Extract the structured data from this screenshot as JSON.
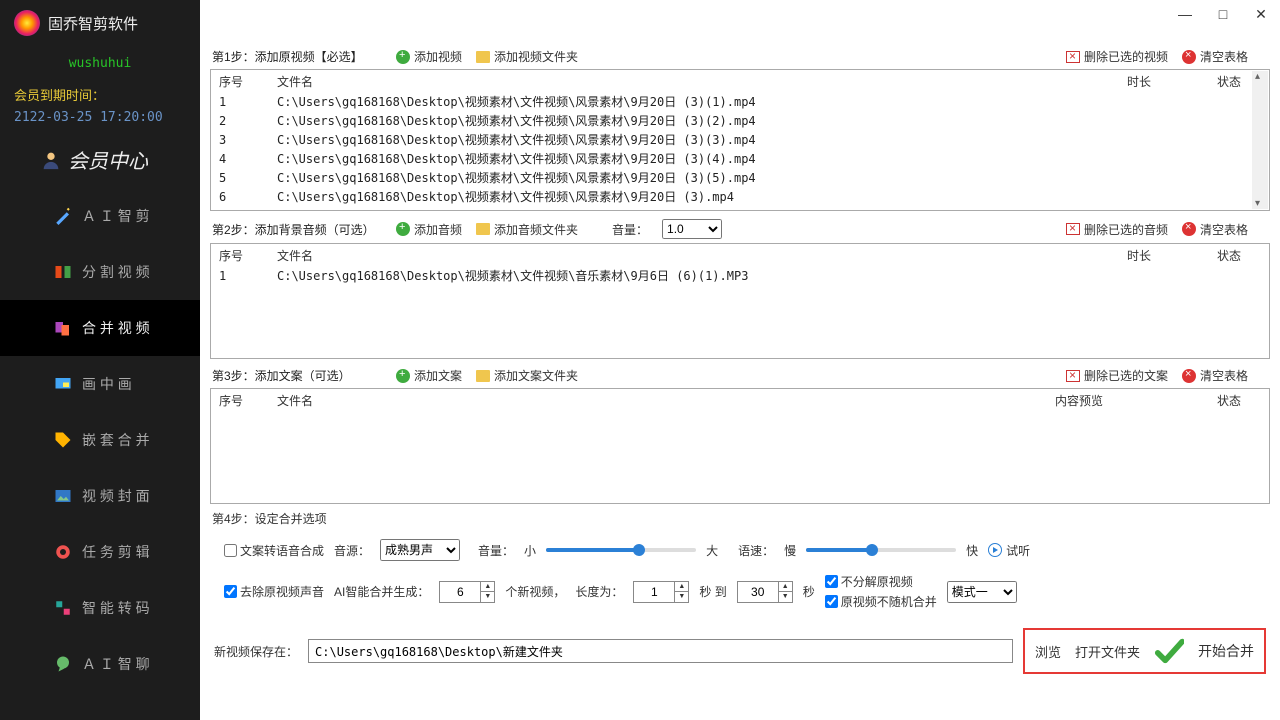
{
  "app": {
    "title": "固乔智剪软件"
  },
  "user": {
    "name": "wushuhui",
    "member_label": "会员到期时间：",
    "member_date": "2122-03-25 17:20:00",
    "member_center": "会员中心"
  },
  "nav": {
    "items": [
      {
        "label": "Ａ Ｉ 智 剪"
      },
      {
        "label": "分 割 视 频"
      },
      {
        "label": "合 并 视 频"
      },
      {
        "label": "画 中 画"
      },
      {
        "label": "嵌 套 合 并"
      },
      {
        "label": "视 频 封 面"
      },
      {
        "label": "任 务 剪 辑"
      },
      {
        "label": "智 能 转 码"
      },
      {
        "label": "Ａ Ｉ 智 聊"
      }
    ]
  },
  "step1": {
    "label": "第1步：添加原视频【必选】",
    "add_video": "添加视频",
    "add_folder": "添加视频文件夹",
    "del_sel": "删除已选的视频",
    "clear": "清空表格",
    "cols": {
      "no": "序号",
      "name": "文件名",
      "dur": "时长",
      "stat": "状态"
    },
    "rows": [
      {
        "no": "1",
        "name": "C:\\Users\\gq168168\\Desktop\\视频素材\\文件视频\\风景素材\\9月20日 (3)(1).mp4"
      },
      {
        "no": "2",
        "name": "C:\\Users\\gq168168\\Desktop\\视频素材\\文件视频\\风景素材\\9月20日 (3)(2).mp4"
      },
      {
        "no": "3",
        "name": "C:\\Users\\gq168168\\Desktop\\视频素材\\文件视频\\风景素材\\9月20日 (3)(3).mp4"
      },
      {
        "no": "4",
        "name": "C:\\Users\\gq168168\\Desktop\\视频素材\\文件视频\\风景素材\\9月20日 (3)(4).mp4"
      },
      {
        "no": "5",
        "name": "C:\\Users\\gq168168\\Desktop\\视频素材\\文件视频\\风景素材\\9月20日 (3)(5).mp4"
      },
      {
        "no": "6",
        "name": "C:\\Users\\gq168168\\Desktop\\视频素材\\文件视频\\风景素材\\9月20日 (3).mp4"
      }
    ]
  },
  "step2": {
    "label": "第2步：添加背景音频（可选）",
    "add_audio": "添加音频",
    "add_folder": "添加音频文件夹",
    "vol_label": "音量：",
    "vol_value": "1.0",
    "del_sel": "删除已选的音频",
    "clear": "清空表格",
    "cols": {
      "no": "序号",
      "name": "文件名",
      "dur": "时长",
      "stat": "状态"
    },
    "rows": [
      {
        "no": "1",
        "name": "C:\\Users\\gq168168\\Desktop\\视频素材\\文件视频\\音乐素材\\9月6日 (6)(1).MP3"
      }
    ]
  },
  "step3": {
    "label": "第3步：添加文案（可选）",
    "add_text": "添加文案",
    "add_folder": "添加文案文件夹",
    "del_sel": "删除已选的文案",
    "clear": "清空表格",
    "cols": {
      "no": "序号",
      "name": "文件名",
      "prev": "内容预览",
      "stat": "状态"
    }
  },
  "step4": {
    "label": "第4步：设定合并选项",
    "tts_cb": "文案转语音合成",
    "voice_label": "音源：",
    "voice_sel": "成熟男声",
    "vol_label": "音量：",
    "vol_small": "小",
    "vol_big": "大",
    "speed_label": "语速：",
    "speed_slow": "慢",
    "speed_fast": "快",
    "listen": "试听",
    "remove_orig": "去除原视频声音",
    "gen_label": "AI智能合并生成：",
    "gen_count": "6",
    "gen_unit": "个新视频，",
    "len_label": "长度为：",
    "len_val": "1",
    "sec_to": "秒 到",
    "len_val2": "30",
    "sec": "秒",
    "no_split": "不分解原视频",
    "no_random": "原视频不随机合并",
    "mode_sel": "模式一"
  },
  "output": {
    "label": "新视频保存在：",
    "path": "C:\\Users\\gq168168\\Desktop\\新建文件夹",
    "browse": "浏览",
    "open": "打开文件夹",
    "start": "开始合并"
  },
  "win": {
    "min": "—",
    "max": "□",
    "close": "✕"
  }
}
